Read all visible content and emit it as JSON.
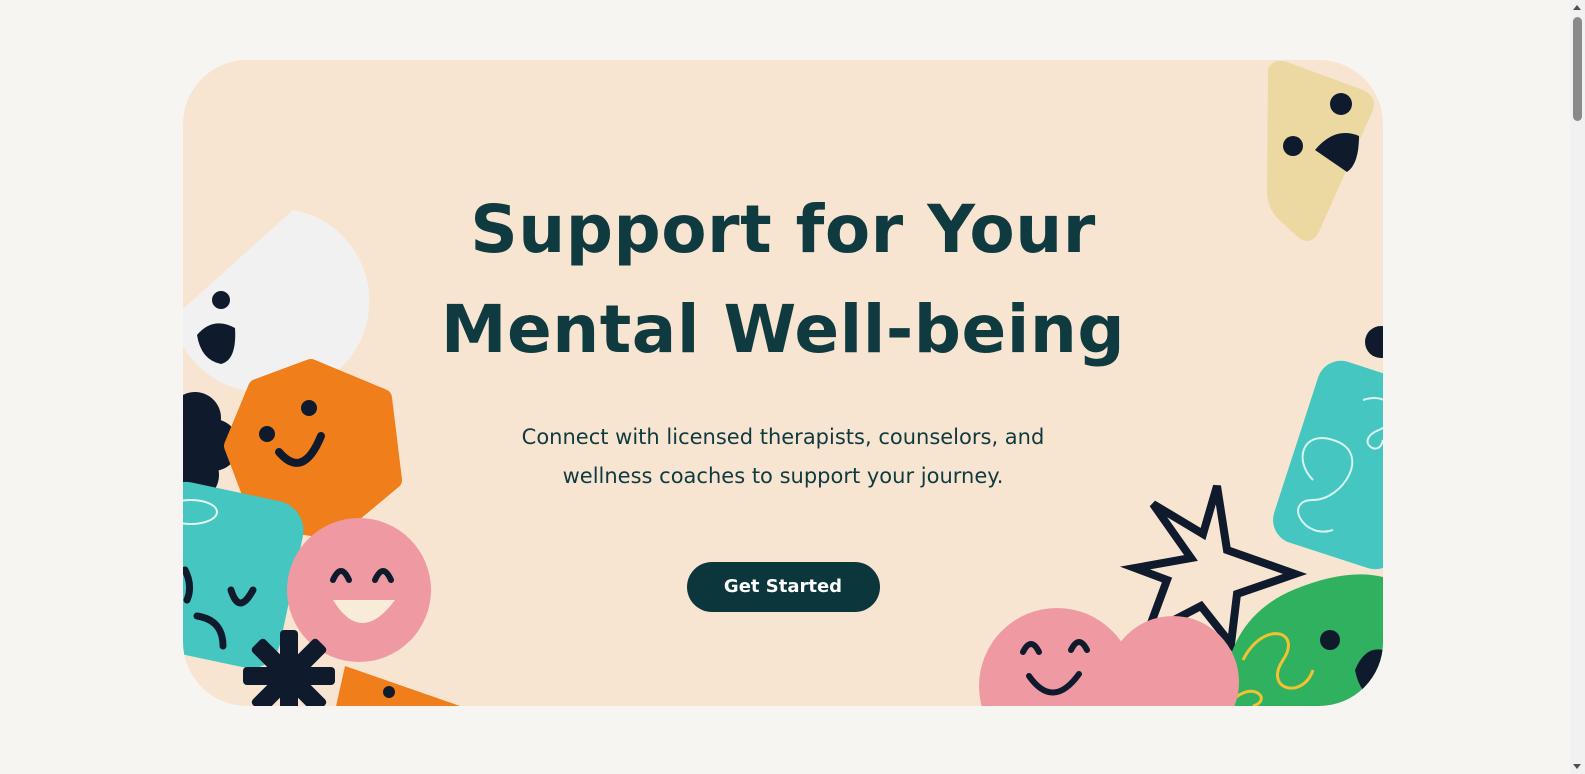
{
  "hero": {
    "title_line1": "Support for Your",
    "title_line2": "Mental Well-being",
    "subtitle_line1": "Connect with licensed therapists, counselors, and",
    "subtitle_line2": "wellness coaches to support your journey.",
    "cta_label": "Get Started"
  },
  "colors": {
    "page_background": "#f7f5f2",
    "hero_background": "#f8e5d1",
    "heading_text": "#0e3a40",
    "button_background": "#0b363c",
    "button_text": "#ffffff",
    "orange": "#f07e1b",
    "pink": "#ef9aa2",
    "teal": "#45c6c0",
    "green": "#2fb15f",
    "yellow": "#ecd9a2",
    "white": "#f1f1f1",
    "navy": "#0f1b2d"
  },
  "illustrations": [
    "white-half-circle-face-icon",
    "navy-flower-icon",
    "orange-hexagon-face-icon",
    "teal-tilted-square-sad-face-icon",
    "pink-circle-laughing-face-icon",
    "navy-asterisk-icon",
    "orange-triangle-face-icon",
    "yellow-triangle-face-icon",
    "teal-scribble-shape-icon",
    "navy-star-outline-icon",
    "pink-cloud-face-icon",
    "green-blob-face-icon"
  ]
}
